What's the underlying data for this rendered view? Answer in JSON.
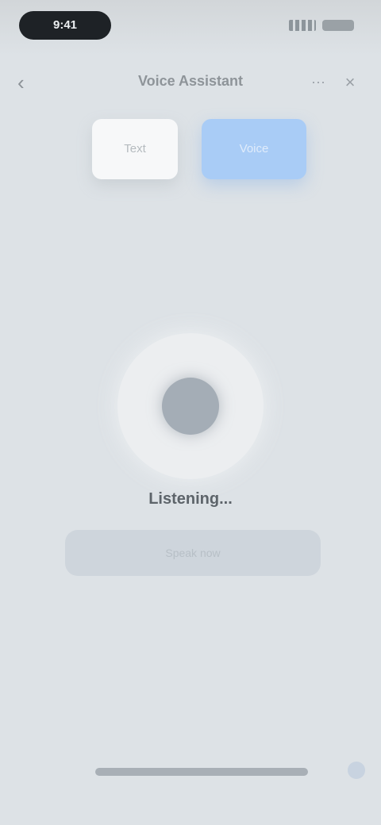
{
  "status_bar": {
    "time": "9:41"
  },
  "header": {
    "back_icon": "chevron-left-icon",
    "title": "Voice Assistant",
    "more_icon": "more-icon",
    "close_icon": "close-icon"
  },
  "mode_tabs": [
    {
      "label": "Text",
      "active": false
    },
    {
      "label": "Voice",
      "active": true
    }
  ],
  "center": {
    "icon": "mic-icon",
    "status": "Listening..."
  },
  "hint": {
    "text": "Speak now"
  },
  "bottom": {
    "icon": "home-indicator"
  },
  "colors": {
    "background": "#dde2e6",
    "accent": "#a9ccf6",
    "ring": "#eceef0"
  }
}
